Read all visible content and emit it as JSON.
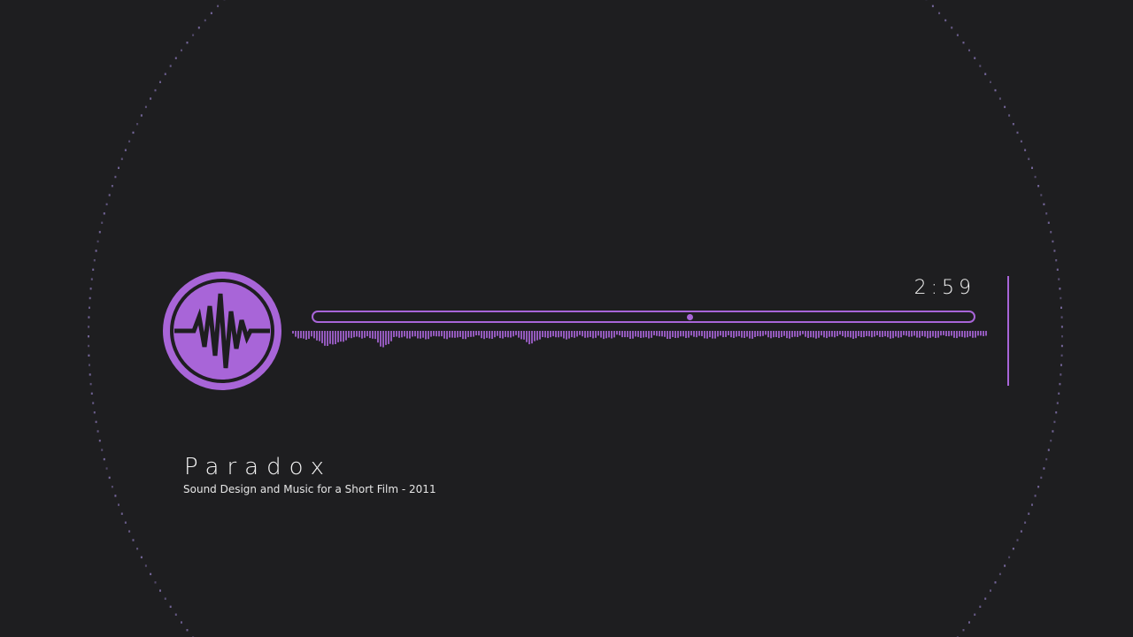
{
  "player": {
    "time": "2:59",
    "progress": 0.57
  },
  "track": {
    "title": "Paradox",
    "subtitle": "Sound Design and Music for a Short Film - 2011"
  },
  "logo": {
    "icon": "waveform-icon"
  },
  "colors": {
    "background": "#1e1e20",
    "accent": "#a865d8",
    "ring": "#8a78b8",
    "text": "#f4f4f4"
  }
}
